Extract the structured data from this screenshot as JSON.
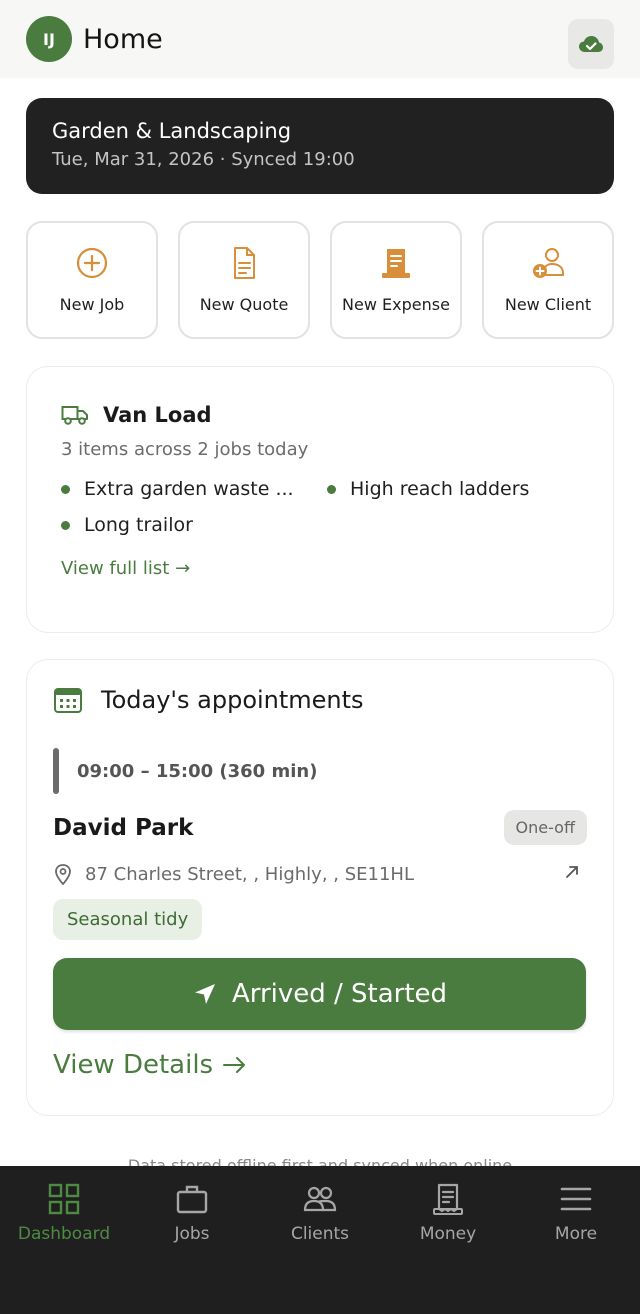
{
  "header": {
    "avatar_initials": "IJ",
    "title": "Home",
    "sync_icon": "cloud-check-icon"
  },
  "banner": {
    "business_name": "Garden & Landscaping",
    "subtitle": "Tue, Mar 31, 2026 · Synced 19:00"
  },
  "quick_actions": [
    {
      "label": "New Job",
      "icon": "plus-circle-icon"
    },
    {
      "label": "New Quote",
      "icon": "document-icon"
    },
    {
      "label": "New Expense",
      "icon": "receipt-icon"
    },
    {
      "label": "New Client",
      "icon": "user-plus-icon"
    }
  ],
  "van_load": {
    "title": "Van Load",
    "summary": "3 items across 2 jobs today",
    "items": [
      "Extra garden waste ...",
      "High reach ladders",
      "Long trailor"
    ],
    "link": "View full list →"
  },
  "appointments": {
    "title": "Today's appointments",
    "time": "09:00 – 15:00 (360 min)",
    "client": "David Park",
    "badge": "One-off",
    "address": "87 Charles Street, , Highly, , SE11HL",
    "tag": "Seasonal tidy",
    "primary_action": "Arrived / Started",
    "details_link": "View Details"
  },
  "footnote": "Data stored offline first and synced when online",
  "nav": [
    {
      "label": "Dashboard",
      "icon": "grid-icon",
      "active": true
    },
    {
      "label": "Jobs",
      "icon": "briefcase-icon",
      "active": false
    },
    {
      "label": "Clients",
      "icon": "users-icon",
      "active": false
    },
    {
      "label": "Money",
      "icon": "receipt-icon",
      "active": false
    },
    {
      "label": "More",
      "icon": "menu-icon",
      "active": false
    }
  ],
  "colors": {
    "accent": "#4a7c3f",
    "orange": "#d98e3a",
    "dark": "#212121"
  }
}
